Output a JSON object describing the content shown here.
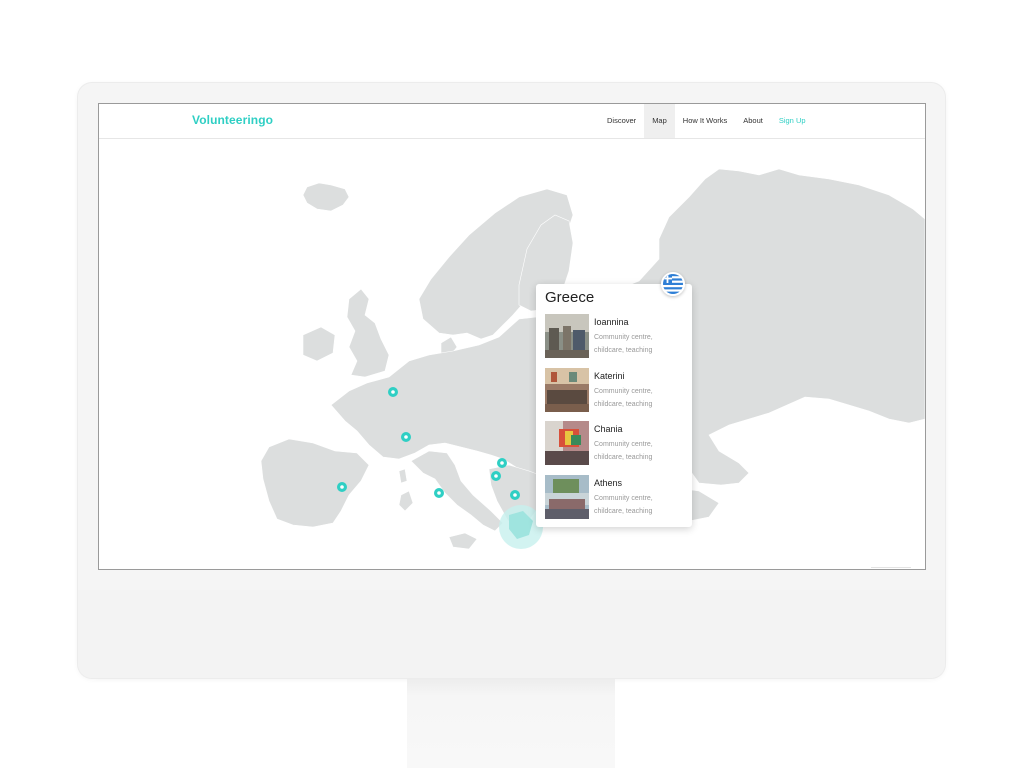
{
  "nav": {
    "logo": "Volunteeringo",
    "links": [
      {
        "label": "Discover",
        "active": false
      },
      {
        "label": "Map",
        "active": true
      },
      {
        "label": "How It Works",
        "active": false
      },
      {
        "label": "About",
        "active": false
      },
      {
        "label": "Sign Up",
        "active": false
      }
    ]
  },
  "popup": {
    "country": "Greece",
    "flag_icon": "greece-flag-icon",
    "locations": [
      {
        "city": "Ioannina",
        "description": "Community centre, childcare, teaching"
      },
      {
        "city": "Katerini",
        "description": "Community centre, childcare, teaching"
      },
      {
        "city": "Chania",
        "description": "Community centre, childcare, teaching"
      },
      {
        "city": "Athens",
        "description": "Community centre, childcare, teaching"
      }
    ]
  },
  "colors": {
    "accent": "#2fcfc4",
    "land": "#dcdede",
    "highlight": "#c7f0ee"
  }
}
